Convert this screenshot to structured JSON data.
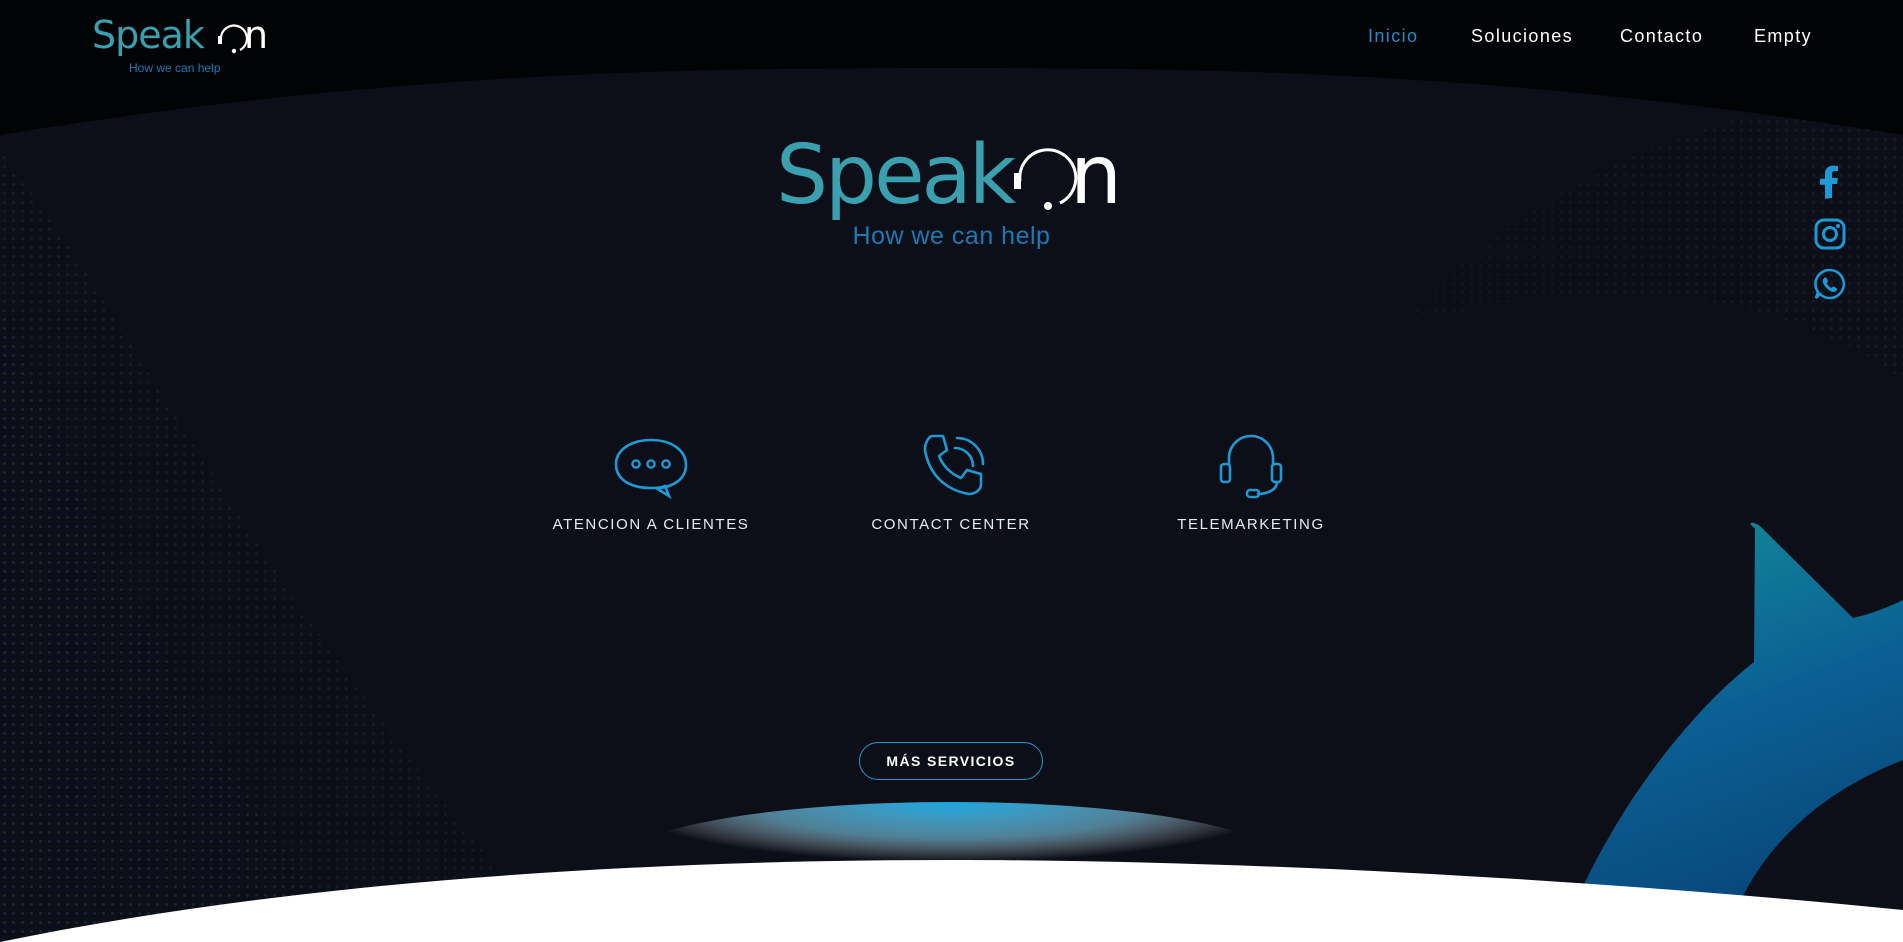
{
  "brand": {
    "name_part1": "Speak",
    "name_part2": "n",
    "tagline": "How we can help"
  },
  "nav": {
    "items": [
      {
        "label": "Inicio",
        "active": true
      },
      {
        "label": "Soluciones",
        "active": false
      },
      {
        "label": "Contacto",
        "active": false
      },
      {
        "label": "Empty",
        "active": false
      }
    ]
  },
  "hero": {
    "logo_part1": "Speak",
    "logo_part2": "n",
    "tagline": "How we can help"
  },
  "social": [
    {
      "icon": "facebook-icon"
    },
    {
      "icon": "instagram-icon"
    },
    {
      "icon": "whatsapp-icon"
    }
  ],
  "services": [
    {
      "icon": "chat-bubble-icon",
      "label": "ATENCION A CLIENTES"
    },
    {
      "icon": "phone-call-icon",
      "label": "CONTACT CENTER"
    },
    {
      "icon": "headset-icon",
      "label": "TELEMARKETING"
    }
  ],
  "cta": {
    "label": "MÁS SERVICIOS"
  },
  "colors": {
    "background": "#0c0f18",
    "header_bg": "#020305",
    "accent_blue": "#1d9ad6",
    "logo_teal": "#3a9fae",
    "nav_active": "#1f8fc9",
    "text_white": "#ffffff"
  }
}
